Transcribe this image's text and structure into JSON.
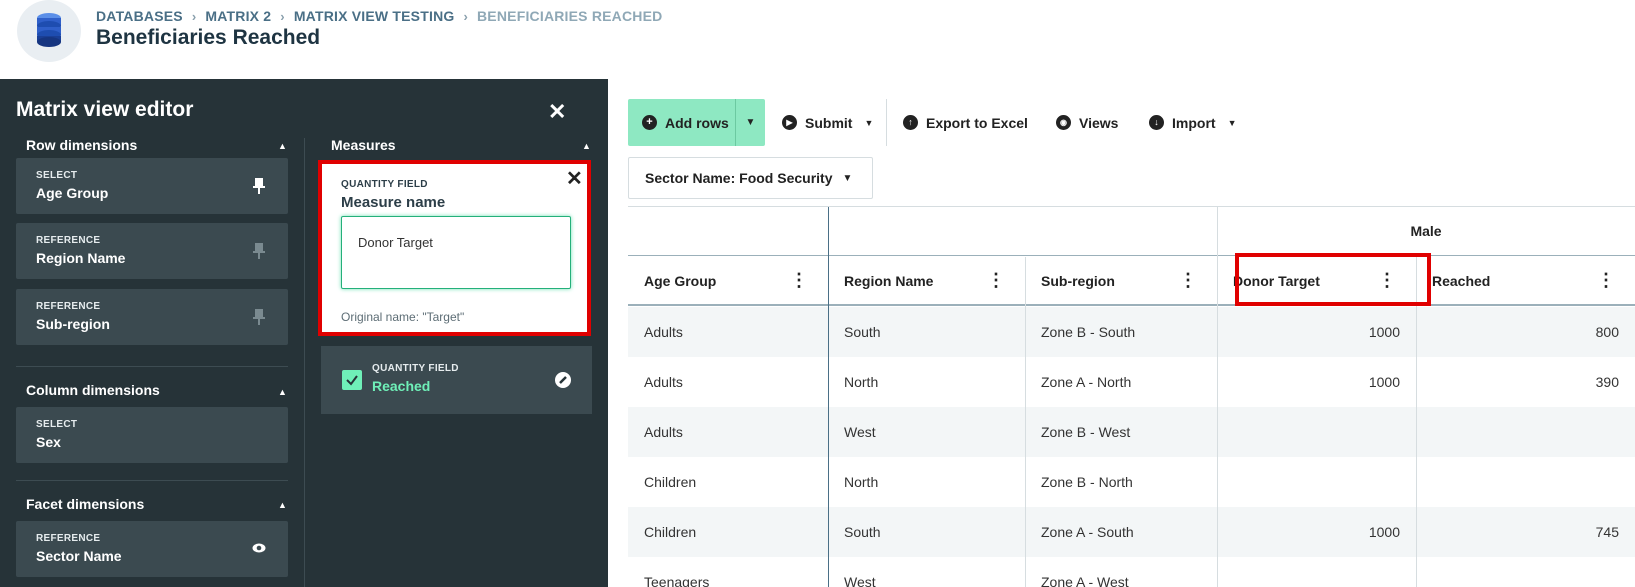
{
  "header": {
    "breadcrumb": [
      "DATABASES",
      "MATRIX 2",
      "MATRIX VIEW TESTING",
      "BENEFICIARIES REACHED"
    ],
    "title": "Beneficiaries Reached",
    "logo_icon": "database-icon"
  },
  "editor": {
    "title": "Matrix view editor",
    "close_icon": "close-icon",
    "row_dimensions": {
      "label": "Row dimensions",
      "items": [
        {
          "type": "SELECT",
          "name": "Age Group",
          "icon": "pin-icon"
        },
        {
          "type": "REFERENCE",
          "name": "Region Name",
          "icon": "pin-icon"
        },
        {
          "type": "REFERENCE",
          "name": "Sub-region",
          "icon": "pin-icon"
        }
      ]
    },
    "column_dimensions": {
      "label": "Column dimensions",
      "items": [
        {
          "type": "SELECT",
          "name": "Sex"
        }
      ]
    },
    "facet_dimensions": {
      "label": "Facet dimensions",
      "items": [
        {
          "type": "REFERENCE",
          "name": "Sector Name",
          "icon": "eye-icon"
        }
      ]
    },
    "measures": {
      "label": "Measures",
      "edit_card": {
        "type": "QUANTITY FIELD",
        "label": "Measure name",
        "value": "Donor Target",
        "original": "Original name: \"Target\""
      },
      "items": [
        {
          "type": "QUANTITY FIELD",
          "name": "Reached",
          "checked": true
        }
      ]
    }
  },
  "toolbar": {
    "add_rows": "Add rows",
    "submit": "Submit",
    "export": "Export to Excel",
    "views": "Views",
    "import": "Import"
  },
  "filter": {
    "label": "Sector Name: Food Security"
  },
  "table": {
    "group_header": "Male",
    "columns": [
      "Age Group",
      "Region Name",
      "Sub-region",
      "Donor Target",
      "Reached"
    ],
    "rows": [
      [
        "Adults",
        "South",
        "Zone B - South",
        "1000",
        "800"
      ],
      [
        "Adults",
        "North",
        "Zone A - North",
        "1000",
        "390"
      ],
      [
        "Adults",
        "West",
        "Zone B - West",
        "",
        ""
      ],
      [
        "Children",
        "North",
        "Zone B - North",
        "",
        ""
      ],
      [
        "Children",
        "South",
        "Zone A - South",
        "1000",
        "745"
      ],
      [
        "Teenagers",
        "West",
        "Zone A - West",
        "",
        ""
      ]
    ]
  },
  "colors": {
    "accent_green": "#8ee8c2",
    "editor_bg": "#263338",
    "highlight_red": "#e00000"
  }
}
